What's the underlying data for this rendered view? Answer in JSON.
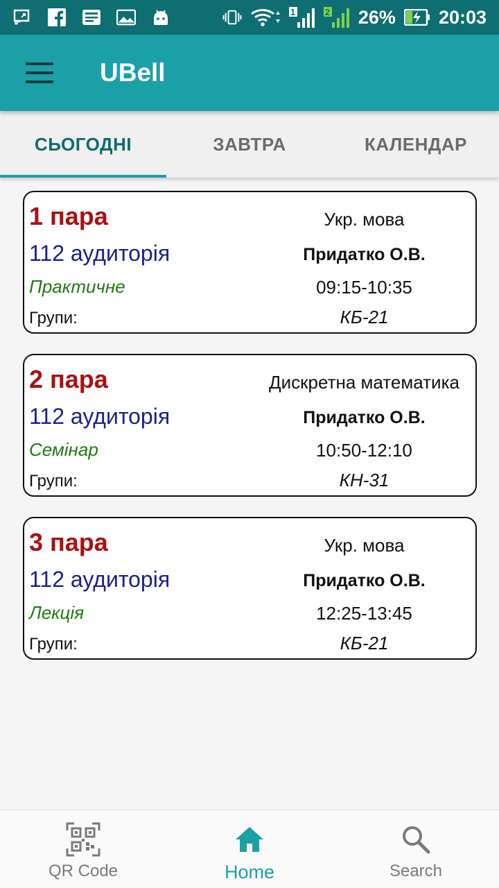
{
  "status_bar": {
    "battery_percent": "26%",
    "time": "20:03",
    "icons": [
      "screencast-icon",
      "facebook-icon",
      "news-icon",
      "gallery-icon",
      "android-icon",
      "vibrate-icon",
      "wifi-icon",
      "signal-sim1-icon",
      "signal-sim2-icon",
      "battery-charging-icon"
    ],
    "sim1_label": "1",
    "sim2_label": "2"
  },
  "app_bar": {
    "title": "UBell",
    "menu_icon": "menu-icon"
  },
  "tabs": [
    {
      "label": "СЬОГОДНІ",
      "active": true
    },
    {
      "label": "ЗАВТРА",
      "active": false
    },
    {
      "label": "КАЛЕНДАР",
      "active": false
    }
  ],
  "lessons": [
    {
      "pair": "1 пара",
      "room": "112 аудиторія",
      "type": "Практичне",
      "groups_label": "Групи:",
      "subject": "Укр. мова",
      "teacher": "Придатко О.В.",
      "time": "09:15-10:35",
      "group": "КБ-21"
    },
    {
      "pair": "2 пара",
      "room": "112 аудиторія",
      "type": "Семінар",
      "groups_label": "Групи:",
      "subject": "Дискретна математика",
      "teacher": "Придатко О.В.",
      "time": "10:50-12:10",
      "group": "КН-31"
    },
    {
      "pair": "3 пара",
      "room": "112 аудиторія",
      "type": "Лекція",
      "groups_label": "Групи:",
      "subject": "Укр. мова",
      "teacher": "Придатко О.В.",
      "time": "12:25-13:45",
      "group": "КБ-21"
    }
  ],
  "bottom_nav": [
    {
      "label": "QR Code",
      "icon": "qr-code-icon",
      "active": false
    },
    {
      "label": "Home",
      "icon": "home-icon",
      "active": true
    },
    {
      "label": "Search",
      "icon": "search-icon",
      "active": false
    }
  ],
  "colors": {
    "status_bar": "#0e6e72",
    "app_bar": "#1ba0a8",
    "accent": "#1ba0a8",
    "pair_red": "#aa1111",
    "room_blue": "#1a1f8c",
    "type_green": "#1f7a12"
  }
}
